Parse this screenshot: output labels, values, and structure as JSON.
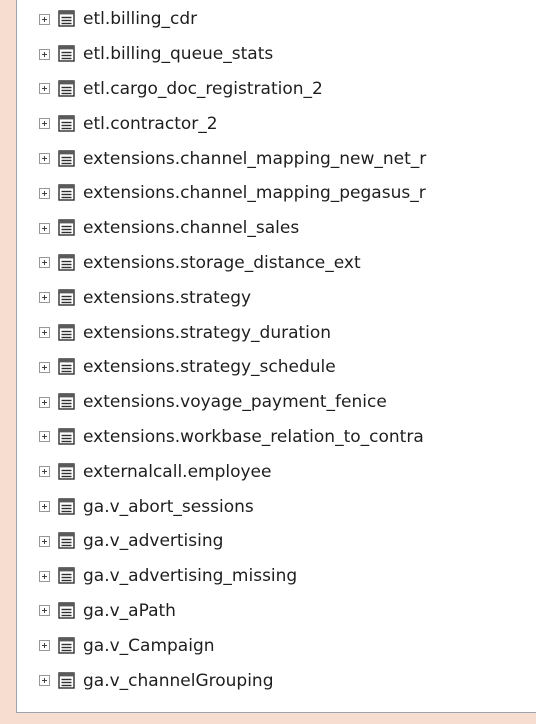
{
  "tree": {
    "items": [
      {
        "label": "etl.billing_cdr"
      },
      {
        "label": "etl.billing_queue_stats"
      },
      {
        "label": "etl.cargo_doc_registration_2"
      },
      {
        "label": "etl.contractor_2"
      },
      {
        "label": "extensions.channel_mapping_new_net_r"
      },
      {
        "label": "extensions.channel_mapping_pegasus_r"
      },
      {
        "label": "extensions.channel_sales"
      },
      {
        "label": "extensions.storage_distance_ext"
      },
      {
        "label": "extensions.strategy"
      },
      {
        "label": "extensions.strategy_duration"
      },
      {
        "label": "extensions.strategy_schedule"
      },
      {
        "label": "extensions.voyage_payment_fenice"
      },
      {
        "label": "extensions.workbase_relation_to_contra"
      },
      {
        "label": "externalcall.employee"
      },
      {
        "label": "ga.v_abort_sessions"
      },
      {
        "label": "ga.v_advertising"
      },
      {
        "label": "ga.v_advertising_missing"
      },
      {
        "label": "ga.v_aPath"
      },
      {
        "label": "ga.v_Campaign"
      },
      {
        "label": "ga.v_channelGrouping"
      }
    ]
  },
  "icons": {
    "expander": "expand-plus-icon",
    "node": "table-icon"
  }
}
